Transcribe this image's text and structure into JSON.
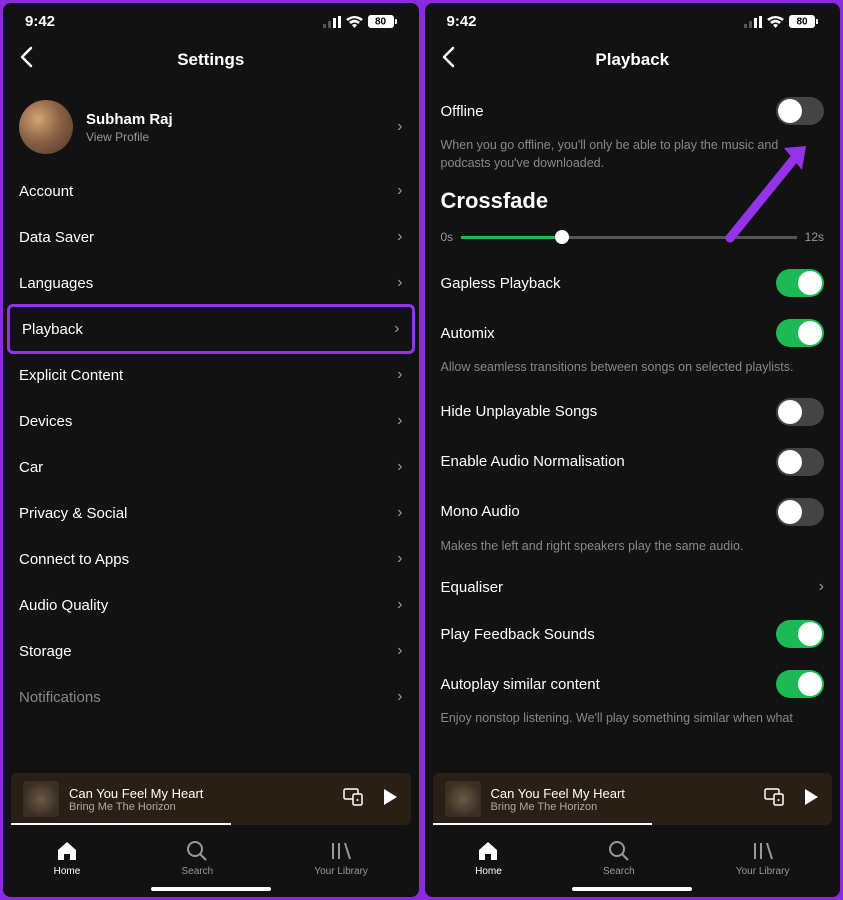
{
  "status": {
    "time": "9:42",
    "battery": "80"
  },
  "left": {
    "title": "Settings",
    "profile": {
      "name": "Subham Raj",
      "sub": "View Profile"
    },
    "items": [
      "Account",
      "Data Saver",
      "Languages",
      "Playback",
      "Explicit Content",
      "Devices",
      "Car",
      "Privacy & Social",
      "Connect to Apps",
      "Audio Quality",
      "Storage",
      "Notifications"
    ]
  },
  "right": {
    "title": "Playback",
    "offline": {
      "label": "Offline",
      "desc": "When you go offline, you'll only be able to play the music and podcasts you've downloaded."
    },
    "crossfade": {
      "title": "Crossfade",
      "min": "0s",
      "max": "12s"
    },
    "gapless": "Gapless Playback",
    "automix": "Automix",
    "automix_desc": "Allow seamless transitions between songs on selected playlists.",
    "hide": "Hide Unplayable Songs",
    "normalize": "Enable Audio Normalisation",
    "mono": "Mono Audio",
    "mono_desc": "Makes the left and right speakers play the same audio.",
    "equaliser": "Equaliser",
    "feedback": "Play Feedback Sounds",
    "autoplay": "Autoplay similar content",
    "autoplay_desc": "Enjoy nonstop listening. We'll play something similar when what"
  },
  "now_playing": {
    "title": "Can You Feel My Heart",
    "artist": "Bring Me The Horizon"
  },
  "tabs": {
    "home": "Home",
    "search": "Search",
    "library": "Your Library"
  }
}
